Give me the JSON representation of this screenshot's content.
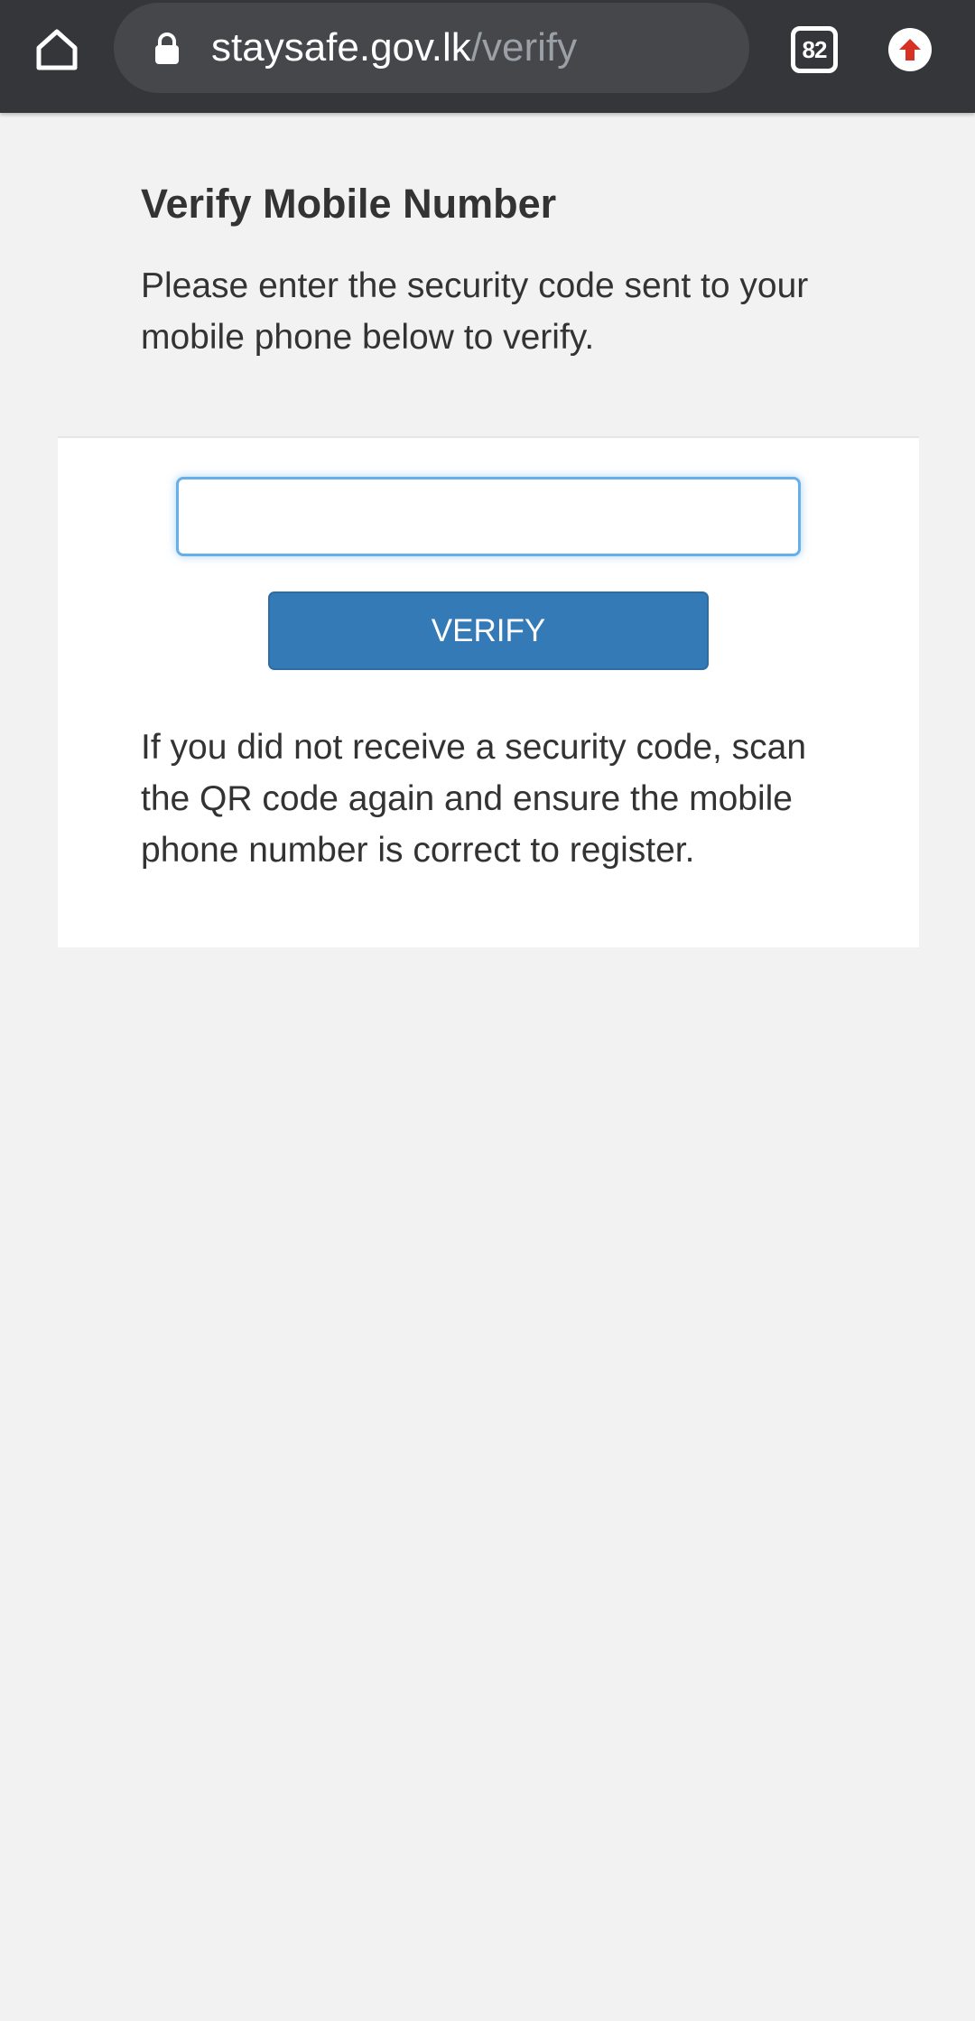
{
  "browser": {
    "url_host": "staysafe.gov.lk",
    "url_path": "/verify",
    "tab_count": "82",
    "icons": {
      "home": "home-icon",
      "lock": "lock-icon",
      "tabs": "tab-switcher-icon",
      "update": "update-arrow-icon"
    },
    "colors": {
      "toolbar": "#35363a",
      "omnibox": "#45474b",
      "update_badge": "#d93025"
    }
  },
  "page": {
    "title": "Verify Mobile Number",
    "intro": "Please enter the security code sent to your mobile phone below to verify.",
    "code_input": {
      "value": "",
      "placeholder": ""
    },
    "verify_label": "VERIFY",
    "help_text": "If you did not receive a security code, scan the QR code again and ensure the mobile phone number is correct to register.",
    "colors": {
      "button": "#337ab7",
      "input_focus": "#66afe9",
      "background": "#f2f2f2"
    }
  }
}
